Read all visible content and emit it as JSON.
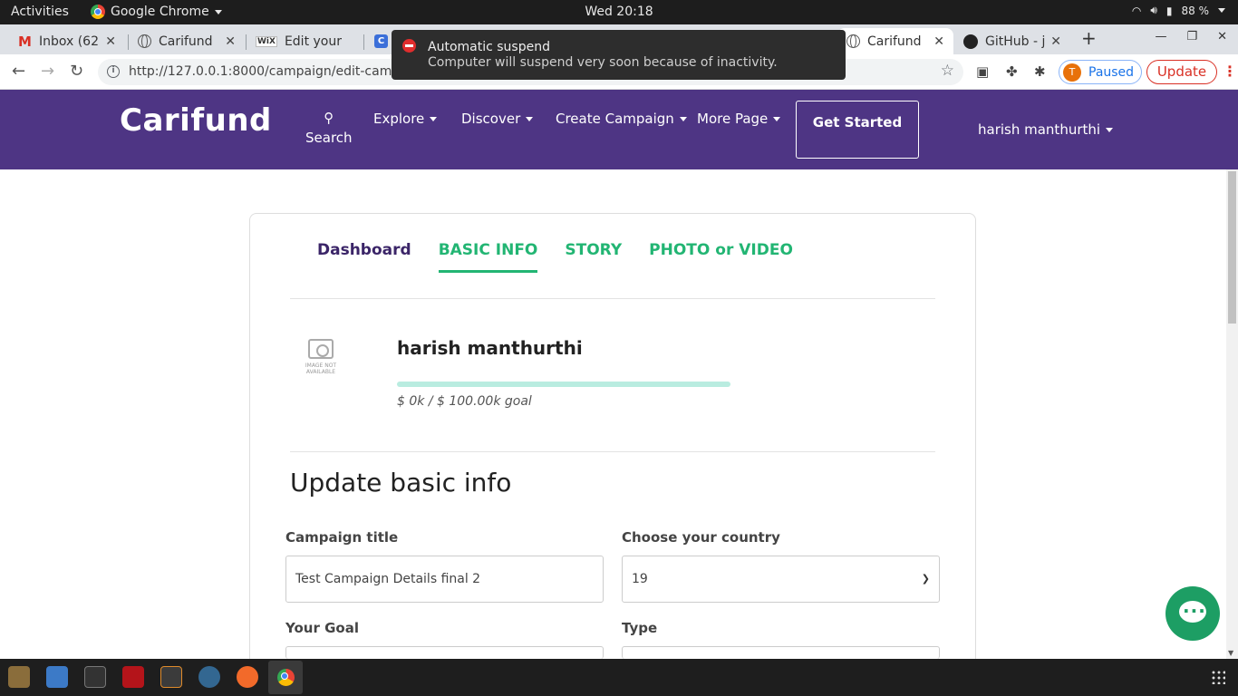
{
  "system": {
    "activities": "Activities",
    "app_name": "Google Chrome",
    "clock": "Wed 20:18",
    "battery": "88 %"
  },
  "tabs": [
    {
      "title": "Inbox (62",
      "icon": "gmail-icon"
    },
    {
      "title": "Carifund",
      "icon": "globe-icon"
    },
    {
      "title": "Edit your",
      "icon": "wix-icon"
    },
    {
      "title": "",
      "icon": "c-icon"
    },
    {
      "title": "Carifund",
      "icon": "globe-icon",
      "active": true
    },
    {
      "title": "GitHub - j",
      "icon": "github-icon"
    }
  ],
  "browser": {
    "url": "http://127.0.0.1:8000/campaign/edit-campaign",
    "profile_initial": "T",
    "profile_status": "Paused",
    "update_label": "Update"
  },
  "notification": {
    "title": "Automatic suspend",
    "body": "Computer will suspend very soon because of inactivity."
  },
  "site_nav": {
    "logo": "Carifund",
    "search_label": "Search",
    "items": [
      "Explore",
      "Discover",
      "Create Campaign",
      "More Page"
    ],
    "get_started": "Get Started",
    "user": "harish manthurthi"
  },
  "campaign_tabs": [
    "Dashboard",
    "BASIC INFO",
    "STORY",
    "PHOTO or VIDEO"
  ],
  "campaign": {
    "image_placeholder": "IMAGE NOT AVAILABLE",
    "owner": "harish manthurthi",
    "goal_text": "$ 0k / $ 100.00k goal",
    "progress_fraction": 0
  },
  "form": {
    "title": "Update basic info",
    "campaign_title_label": "Campaign title",
    "campaign_title_value": "Test Campaign Details final 2",
    "country_label": "Choose your country",
    "country_value": "19",
    "goal_label": "Your Goal",
    "type_label": "Type"
  },
  "colors": {
    "nav_bg": "#4e3584",
    "accent_green": "#22b573",
    "dashboard_text": "#3b2568"
  }
}
